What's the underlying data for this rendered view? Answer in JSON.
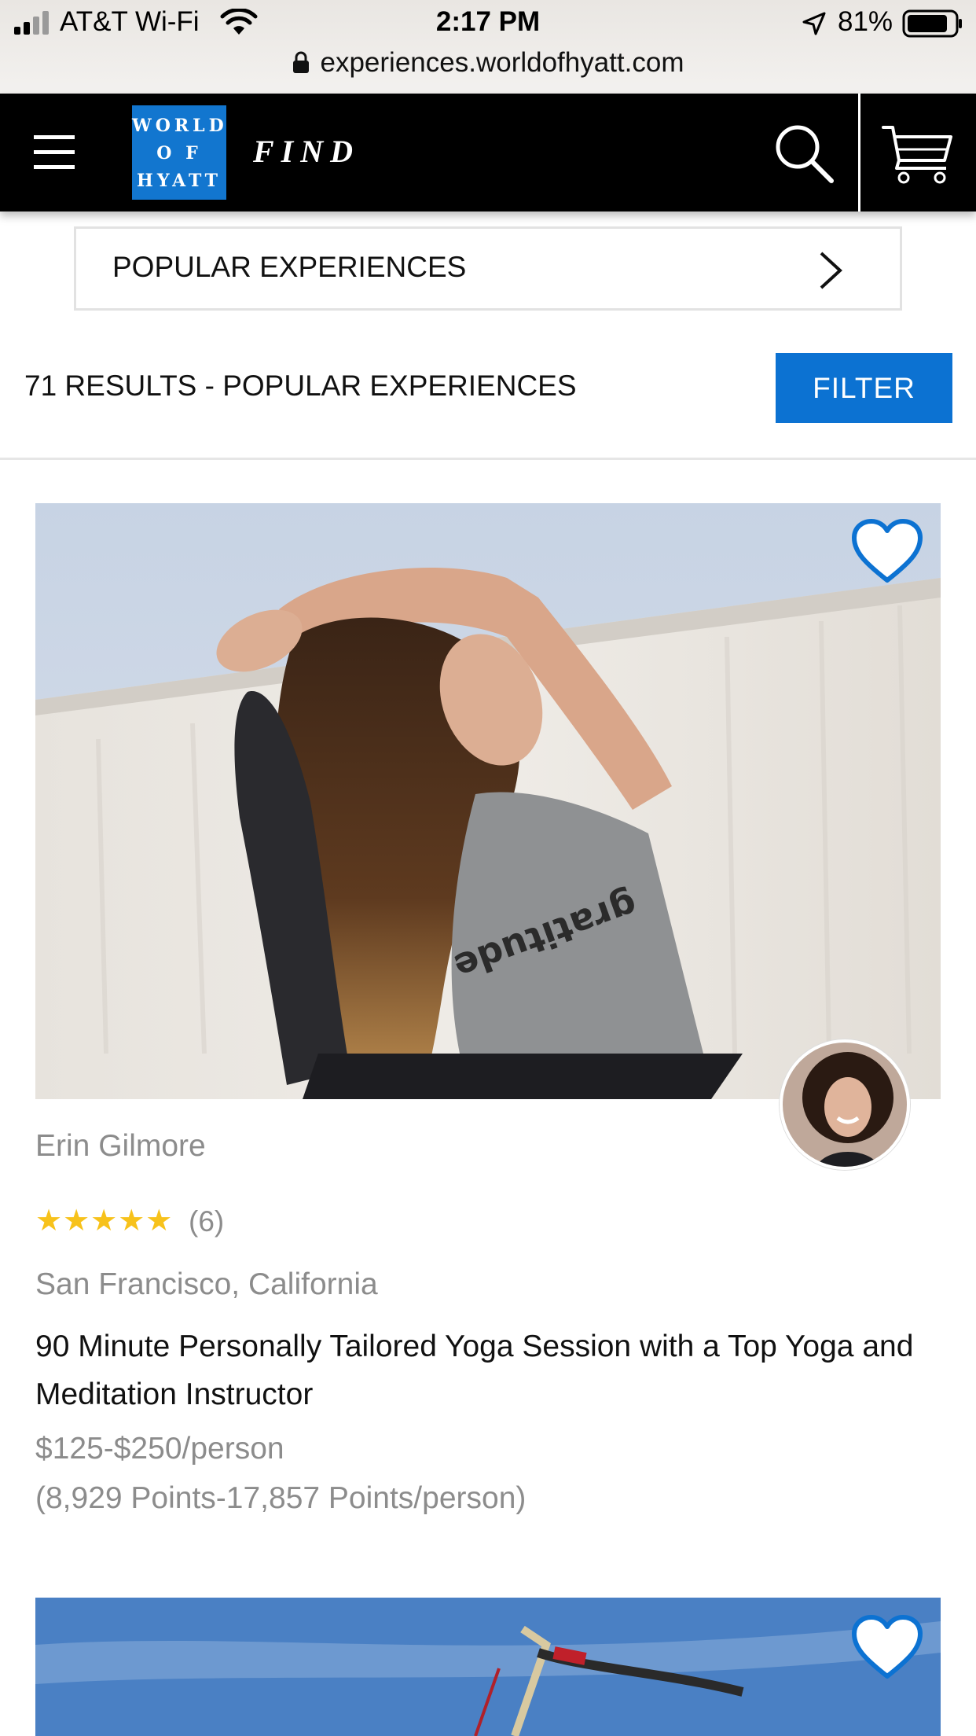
{
  "status_bar": {
    "carrier": "AT&T Wi-Fi",
    "time": "2:17 PM",
    "battery": "81%"
  },
  "browser": {
    "url": "experiences.worldofhyatt.com"
  },
  "header": {
    "logo_line1": "WORLD",
    "logo_line2": "O F",
    "logo_line3": "HYATT",
    "find_label": "FIND",
    "icons": [
      "menu-icon",
      "search-icon",
      "cart-icon"
    ]
  },
  "category": {
    "label": "POPULAR EXPERIENCES"
  },
  "results": {
    "count_text": "71 RESULTS - POPULAR EXPERIENCES",
    "filter_label": "FILTER"
  },
  "cards": [
    {
      "host_name": "Erin Gilmore",
      "stars": "★★★★★",
      "rating": 5,
      "review_count": "(6)",
      "location": "San Francisco, California",
      "title": "90 Minute Personally Tailored Yoga Session with a Top Yoga and Meditation Instructor",
      "price": "$125-$250/person",
      "points": "(8,929 Points-17,857 Points/person)",
      "shirt_text": "gratitude"
    }
  ],
  "colors": {
    "brand_blue": "#0c72d2",
    "header_bg": "#000000",
    "star_yellow": "#f7c21b",
    "muted_text": "#8c8c8c"
  }
}
